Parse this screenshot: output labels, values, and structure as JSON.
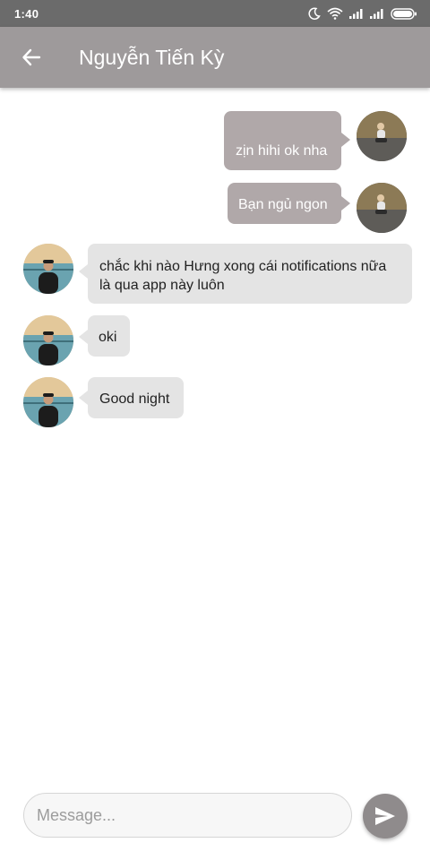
{
  "status_bar": {
    "time": "1:40",
    "icons": [
      "moon-icon",
      "wifi-icon",
      "signal-icon",
      "signal-icon",
      "battery-icon"
    ]
  },
  "header": {
    "back_icon": "arrow-left-icon",
    "title": "Nguyễn Tiến Kỳ"
  },
  "messages": [
    {
      "direction": "outgoing",
      "text": "zịn hihi ok nha"
    },
    {
      "direction": "outgoing",
      "text": "Bạn ngủ ngon"
    },
    {
      "direction": "incoming",
      "line1": "chắc khi nào Hưng xong cái notifications nữa",
      "line2": "là qua app này luôn"
    },
    {
      "direction": "incoming",
      "text": "oki"
    },
    {
      "direction": "incoming",
      "text": "Good night"
    }
  ],
  "composer": {
    "placeholder": "Message...",
    "value": "",
    "send_icon": "send-icon"
  },
  "colors": {
    "status_bar": "#6b6b6b",
    "app_bar": "#9e9a9b",
    "outgoing_bubble": "#b0a8a9",
    "incoming_bubble": "#e4e4e4",
    "send_button": "#8f8b8c"
  }
}
